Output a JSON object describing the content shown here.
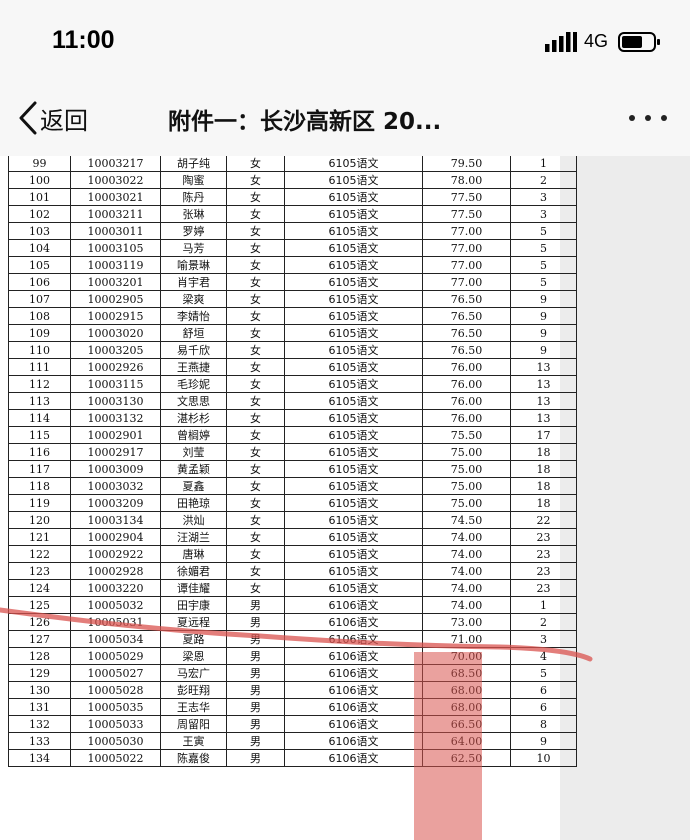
{
  "status_bar": {
    "time": "11:00",
    "network": "4G"
  },
  "nav": {
    "back_label": "返回",
    "title": "附件一：长沙高新区 20..."
  },
  "table": {
    "rows": [
      [
        "99",
        "10003217",
        "胡子纯",
        "女",
        "6105语文",
        "79.50",
        "1"
      ],
      [
        "100",
        "10003022",
        "陶蜜",
        "女",
        "6105语文",
        "78.00",
        "2"
      ],
      [
        "101",
        "10003021",
        "陈丹",
        "女",
        "6105语文",
        "77.50",
        "3"
      ],
      [
        "102",
        "10003211",
        "张琳",
        "女",
        "6105语文",
        "77.50",
        "3"
      ],
      [
        "103",
        "10003011",
        "罗婷",
        "女",
        "6105语文",
        "77.00",
        "5"
      ],
      [
        "104",
        "10003105",
        "马芳",
        "女",
        "6105语文",
        "77.00",
        "5"
      ],
      [
        "105",
        "10003119",
        "喻景琳",
        "女",
        "6105语文",
        "77.00",
        "5"
      ],
      [
        "106",
        "10003201",
        "肖宇君",
        "女",
        "6105语文",
        "77.00",
        "5"
      ],
      [
        "107",
        "10002905",
        "梁爽",
        "女",
        "6105语文",
        "76.50",
        "9"
      ],
      [
        "108",
        "10002915",
        "李婧怡",
        "女",
        "6105语文",
        "76.50",
        "9"
      ],
      [
        "109",
        "10003020",
        "舒垣",
        "女",
        "6105语文",
        "76.50",
        "9"
      ],
      [
        "110",
        "10003205",
        "易千欣",
        "女",
        "6105语文",
        "76.50",
        "9"
      ],
      [
        "111",
        "10002926",
        "王燕捷",
        "女",
        "6105语文",
        "76.00",
        "13"
      ],
      [
        "112",
        "10003115",
        "毛珍妮",
        "女",
        "6105语文",
        "76.00",
        "13"
      ],
      [
        "113",
        "10003130",
        "文思思",
        "女",
        "6105语文",
        "76.00",
        "13"
      ],
      [
        "114",
        "10003132",
        "湛杉杉",
        "女",
        "6105语文",
        "76.00",
        "13"
      ],
      [
        "115",
        "10002901",
        "曾榈婷",
        "女",
        "6105语文",
        "75.50",
        "17"
      ],
      [
        "116",
        "10002917",
        "刘莹",
        "女",
        "6105语文",
        "75.00",
        "18"
      ],
      [
        "117",
        "10003009",
        "黄孟颖",
        "女",
        "6105语文",
        "75.00",
        "18"
      ],
      [
        "118",
        "10003032",
        "夏鑫",
        "女",
        "6105语文",
        "75.00",
        "18"
      ],
      [
        "119",
        "10003209",
        "田艳琼",
        "女",
        "6105语文",
        "75.00",
        "18"
      ],
      [
        "120",
        "10003134",
        "洪灿",
        "女",
        "6105语文",
        "74.50",
        "22"
      ],
      [
        "121",
        "10002904",
        "汪湖兰",
        "女",
        "6105语文",
        "74.00",
        "23"
      ],
      [
        "122",
        "10002922",
        "唐琳",
        "女",
        "6105语文",
        "74.00",
        "23"
      ],
      [
        "123",
        "10002928",
        "徐媚君",
        "女",
        "6105语文",
        "74.00",
        "23"
      ],
      [
        "124",
        "10003220",
        "谭佳耀",
        "女",
        "6105语文",
        "74.00",
        "23"
      ],
      [
        "125",
        "10005032",
        "田宇康",
        "男",
        "6106语文",
        "74.00",
        "1"
      ],
      [
        "126",
        "10005031",
        "夏远程",
        "男",
        "6106语文",
        "73.00",
        "2"
      ],
      [
        "127",
        "10005034",
        "夏路",
        "男",
        "6106语文",
        "71.00",
        "3"
      ],
      [
        "128",
        "10005029",
        "梁恩",
        "男",
        "6106语文",
        "70.00",
        "4"
      ],
      [
        "129",
        "10005027",
        "马宏广",
        "男",
        "6106语文",
        "68.50",
        "5"
      ],
      [
        "130",
        "10005028",
        "彭旺翔",
        "男",
        "6106语文",
        "68.00",
        "6"
      ],
      [
        "131",
        "10005035",
        "王志华",
        "男",
        "6106语文",
        "68.00",
        "6"
      ],
      [
        "132",
        "10005033",
        "周留阳",
        "男",
        "6106语文",
        "66.50",
        "8"
      ],
      [
        "133",
        "10005030",
        "王寅",
        "男",
        "6106语文",
        "64.00",
        "9"
      ],
      [
        "134",
        "10005022",
        "陈嘉俊",
        "男",
        "6106语文",
        "62.50",
        "10"
      ]
    ]
  },
  "colors": {
    "annotation_red": "#d9534f",
    "text": "#111111",
    "bar_bg": "#f7f7f7",
    "margin_gray": "#ececec"
  },
  "icons": {
    "back": "chevron-left-icon",
    "more": "ellipsis-icon",
    "signal": "signal-bars-icon",
    "battery": "battery-icon"
  }
}
